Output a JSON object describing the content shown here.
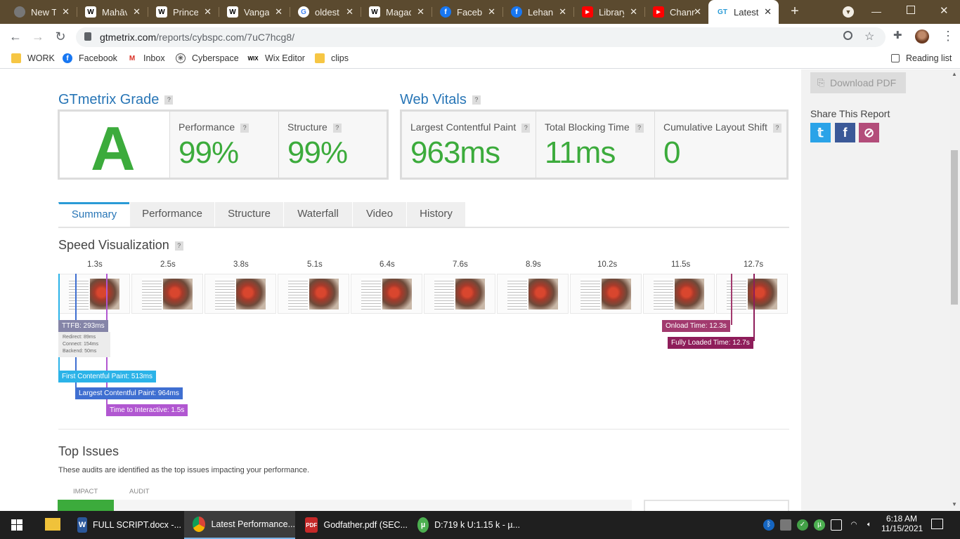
{
  "browser": {
    "tabs": [
      {
        "label": "New Ta",
        "icon": "chrome-icon",
        "color": "#5f6368"
      },
      {
        "label": "Mahāv",
        "icon": "wikipedia-icon",
        "color": "#ffffff"
      },
      {
        "label": "Prince",
        "icon": "wikipedia-icon",
        "color": "#ffffff"
      },
      {
        "label": "Vanga",
        "icon": "wikipedia-icon",
        "color": "#ffffff"
      },
      {
        "label": "oldest",
        "icon": "google-icon",
        "color": "#ffffff"
      },
      {
        "label": "Magad",
        "icon": "wikipedia-icon",
        "color": "#ffffff"
      },
      {
        "label": "Facebo",
        "icon": "facebook-icon",
        "color": "#1877f2"
      },
      {
        "label": "Lehan",
        "icon": "facebook-icon",
        "color": "#1877f2"
      },
      {
        "label": "Library",
        "icon": "youtube-icon",
        "color": "#ff0000"
      },
      {
        "label": "Chann",
        "icon": "youtube-icon",
        "color": "#ff0000"
      },
      {
        "label": "Latest",
        "icon": "gtmetrix-icon",
        "color": "#2a9bd6"
      }
    ],
    "url_host": "gtmetrix.com",
    "url_path": "/reports/cybspc.com/7uC7hcg8/",
    "bookmarks": [
      {
        "label": "WORK",
        "icon": "folder-icon"
      },
      {
        "label": "Facebook",
        "icon": "facebook-icon"
      },
      {
        "label": "Inbox",
        "icon": "gmail-icon"
      },
      {
        "label": "Cyberspace",
        "icon": "cyberspace-icon"
      },
      {
        "label": "Wix Editor",
        "icon": "wix-icon"
      },
      {
        "label": "clips",
        "icon": "folder-icon"
      }
    ],
    "reading_list": "Reading list"
  },
  "report": {
    "grade_title": "GTmetrix Grade",
    "grade": "A",
    "performance_label": "Performance",
    "performance_value": "99%",
    "structure_label": "Structure",
    "structure_value": "99%",
    "vitals_title": "Web Vitals",
    "lcp_label": "Largest Contentful Paint",
    "lcp_value": "963ms",
    "tbt_label": "Total Blocking Time",
    "tbt_value": "11ms",
    "cls_label": "Cumulative Layout Shift",
    "cls_value": "0",
    "help": "?"
  },
  "tabs": [
    "Summary",
    "Performance",
    "Structure",
    "Waterfall",
    "Video",
    "History"
  ],
  "speed": {
    "title": "Speed Visualization",
    "ticks": [
      "1.3s",
      "2.5s",
      "3.8s",
      "5.1s",
      "6.4s",
      "7.6s",
      "8.9s",
      "10.2s",
      "11.5s",
      "12.7s"
    ],
    "ttfb": "TTFB: 293ms",
    "redirect": "Redirect: 89ms",
    "connect": "Connect: 154ms",
    "backend": "Backend: 50ms",
    "fcp": "First Contentful Paint: 513ms",
    "lcp": "Largest Contentful Paint: 964ms",
    "tti": "Time to Interactive: 1.5s",
    "onload": "Onload Time: 12.3s",
    "fully_loaded": "Fully Loaded Time: 12.7s"
  },
  "top_issues": {
    "title": "Top Issues",
    "description": "These audits are identified as the top issues impacting your performance.",
    "col_impact": "IMPACT",
    "col_audit": "AUDIT"
  },
  "sidebar": {
    "download_pdf": "Download PDF",
    "share_title": "Share This Report"
  },
  "taskbar": {
    "items": [
      {
        "label": "FULL SCRIPT.docx -...",
        "icon": "word-icon"
      },
      {
        "label": "Latest Performance...",
        "icon": "chrome-icon"
      },
      {
        "label": "Godfather.pdf (SEC...",
        "icon": "pdf-icon"
      },
      {
        "label": "D:719 k U:1.15 k - µ...",
        "icon": "utorrent-icon"
      }
    ],
    "time": "6:18 AM",
    "date": "11/15/2021"
  }
}
